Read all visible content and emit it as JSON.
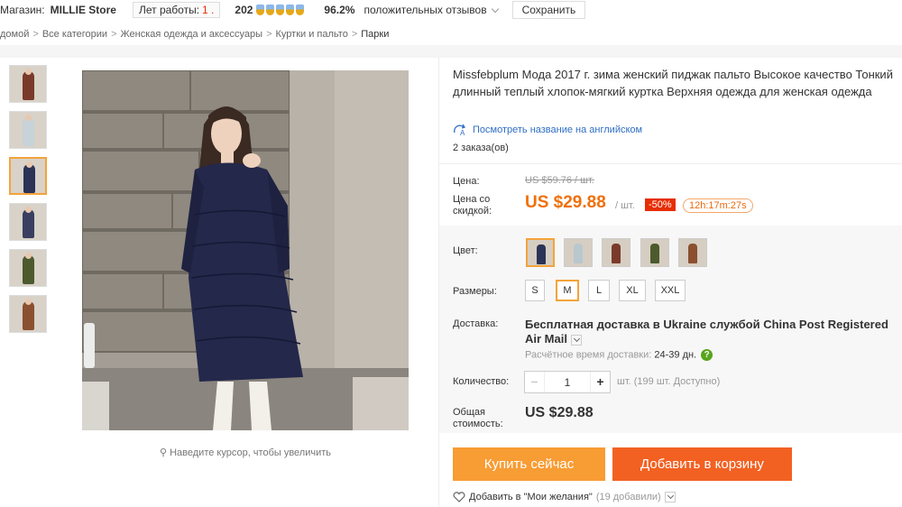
{
  "store": {
    "store_label": "Магазин:",
    "store_name": "MILLIE Store",
    "years_label": "Лет работы:",
    "years_value": "1 .",
    "feedback_count": "202",
    "rating_percent": "96.2%",
    "rating_label": "положительных отзывов",
    "save_label": "Сохранить"
  },
  "breadcrumb": [
    "домой",
    "Все категории",
    "Женская одежда и аксессуары",
    "Куртки и пальто",
    "Парки"
  ],
  "gallery": {
    "zoom_hint": "Наведите курсор, чтобы увеличить",
    "thumb_colors": [
      "#7a3a2a",
      "#c7d3d8",
      "#2b3356",
      "#3a3e60",
      "#4c5a2e",
      "#8a5030"
    ]
  },
  "product": {
    "title": "Missfebplum Мода 2017 г. зима женский пиджак пальто Высокое качество Тонкий длинный теплый хлопок-мягкий куртка Верхняя одежда для женская одежда",
    "translate_link": "Посмотреть название на английском",
    "orders": "2 заказа(ов)"
  },
  "price": {
    "price_label": "Цена:",
    "old_price": "US $59.76 / шт.",
    "discount_label_1": "Цена со",
    "discount_label_2": "скидкой:",
    "new_price": "US $29.88",
    "unit": "/ шт.",
    "discount": "-50%",
    "timer": "12h:17m:27s"
  },
  "options": {
    "color_label": "Цвет:",
    "swatch_colors": [
      "#2b3356",
      "#b9c7cf",
      "#7a3a2a",
      "#4c5a2e",
      "#8a5030"
    ],
    "size_label": "Размеры:",
    "sizes": [
      "S",
      "M",
      "L",
      "XL",
      "XXL"
    ],
    "selected_size": "M"
  },
  "shipping": {
    "label": "Доставка:",
    "text": "Бесплатная доставка в Ukraine службой China Post Registered Air Mail",
    "eta_label": "Расчётное время доставки:",
    "eta_days": "24-39 дн."
  },
  "quantity": {
    "label": "Количество:",
    "value": "1",
    "minus": "−",
    "plus": "+",
    "available": "шт. (199 шт. Доступно)"
  },
  "total": {
    "label_1": "Общая",
    "label_2": "стоимость:",
    "value": "US $29.88"
  },
  "actions": {
    "buy_now": "Купить сейчас",
    "add_to_cart": "Добавить в корзину",
    "wishlist": "Добавить в \"Мои желания\"",
    "wishlist_count": "(19 добавили)"
  },
  "colors": {
    "accent_orange": "#f89c34",
    "cart_orange": "#f26122",
    "price_orange": "#f0700a",
    "discount_red": "#e62e04",
    "link_blue": "#2f6ec4",
    "selected_border": "#f4a33b"
  }
}
